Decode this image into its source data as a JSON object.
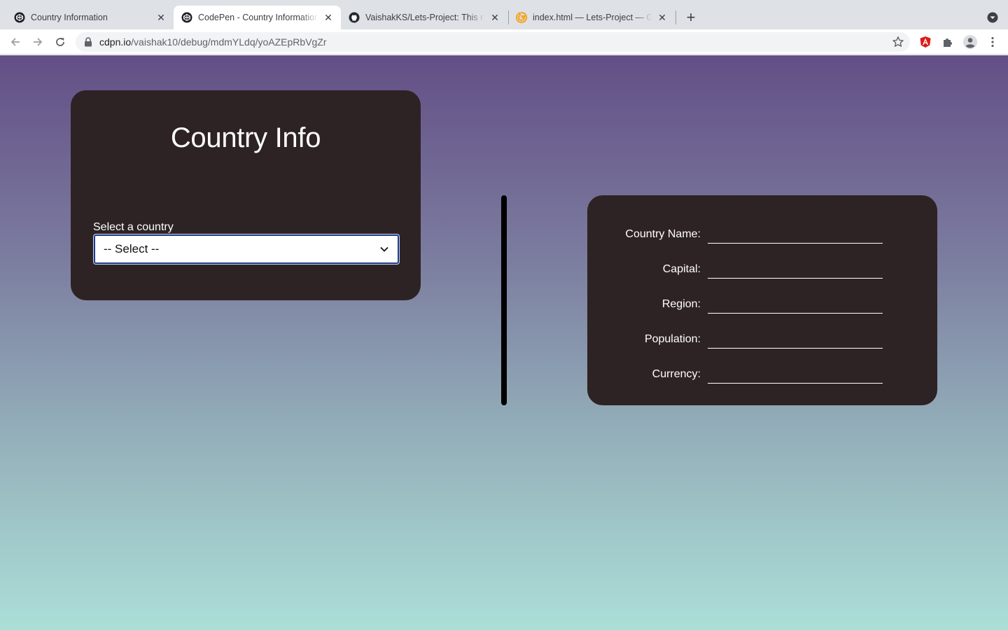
{
  "browser": {
    "tabs": [
      {
        "title": "Country Information",
        "icon": "codepen-icon",
        "active": false
      },
      {
        "title": "CodePen - Country Information",
        "icon": "codepen-icon",
        "active": true
      },
      {
        "title": "VaishakKS/Lets-Project: This r",
        "icon": "github-icon",
        "active": false
      },
      {
        "title": "index.html — Lets-Project — G",
        "icon": "glitch-icon",
        "active": false
      }
    ],
    "url_host": "cdpn.io",
    "url_path": "/vaishak10/debug/mdmYLdq/yoAZEpRbVgZr"
  },
  "page": {
    "title": "Country Info",
    "select_label": "Select a country",
    "select_value": "-- Select --",
    "fields": [
      {
        "label": "Country Name:",
        "value": ""
      },
      {
        "label": "Capital:",
        "value": ""
      },
      {
        "label": "Region:",
        "value": ""
      },
      {
        "label": "Population:",
        "value": ""
      },
      {
        "label": "Currency:",
        "value": ""
      }
    ]
  },
  "colors": {
    "card_bg": "#2e2324",
    "gradient_top": "#634f86",
    "gradient_bottom": "#acdfd8",
    "select_border": "#1f3b82"
  }
}
